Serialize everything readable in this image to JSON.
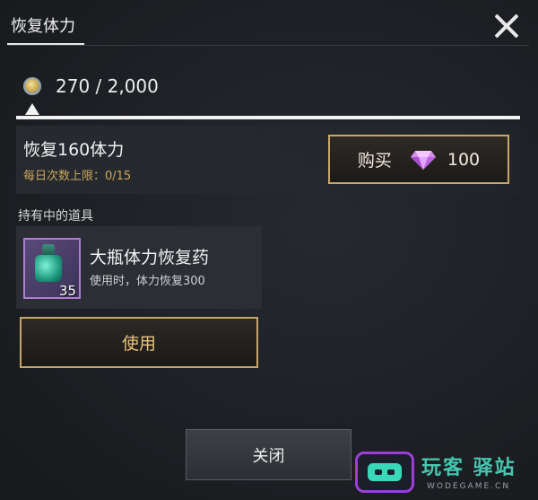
{
  "window": {
    "title": "恢复体力"
  },
  "stamina": {
    "icon": "stamina-coin-icon",
    "value_text": "270 / 2,000",
    "slider_fraction": 0.01
  },
  "recover": {
    "title": "恢复160体力",
    "daily_limit": "每日次数上限：0/15",
    "buy_label": "购买",
    "price_icon": "diamond-gem-icon",
    "price": "100"
  },
  "items": {
    "header": "持有中的道具",
    "list": [
      {
        "icon": "large-stamina-potion-icon",
        "count": "35",
        "name": "大瓶体力恢复药",
        "description": "使用时，体力恢复300"
      }
    ],
    "use_label": "使用"
  },
  "footer": {
    "close_label": "关闭"
  },
  "watermark": {
    "brand": "玩客 驿站",
    "url": "WODEGAME.CN"
  },
  "colors": {
    "accent_gold": "#c8a66a",
    "limit_text": "#c9a95a",
    "gem_purple": "#c77ce0",
    "watermark_teal": "#46c7b0"
  }
}
